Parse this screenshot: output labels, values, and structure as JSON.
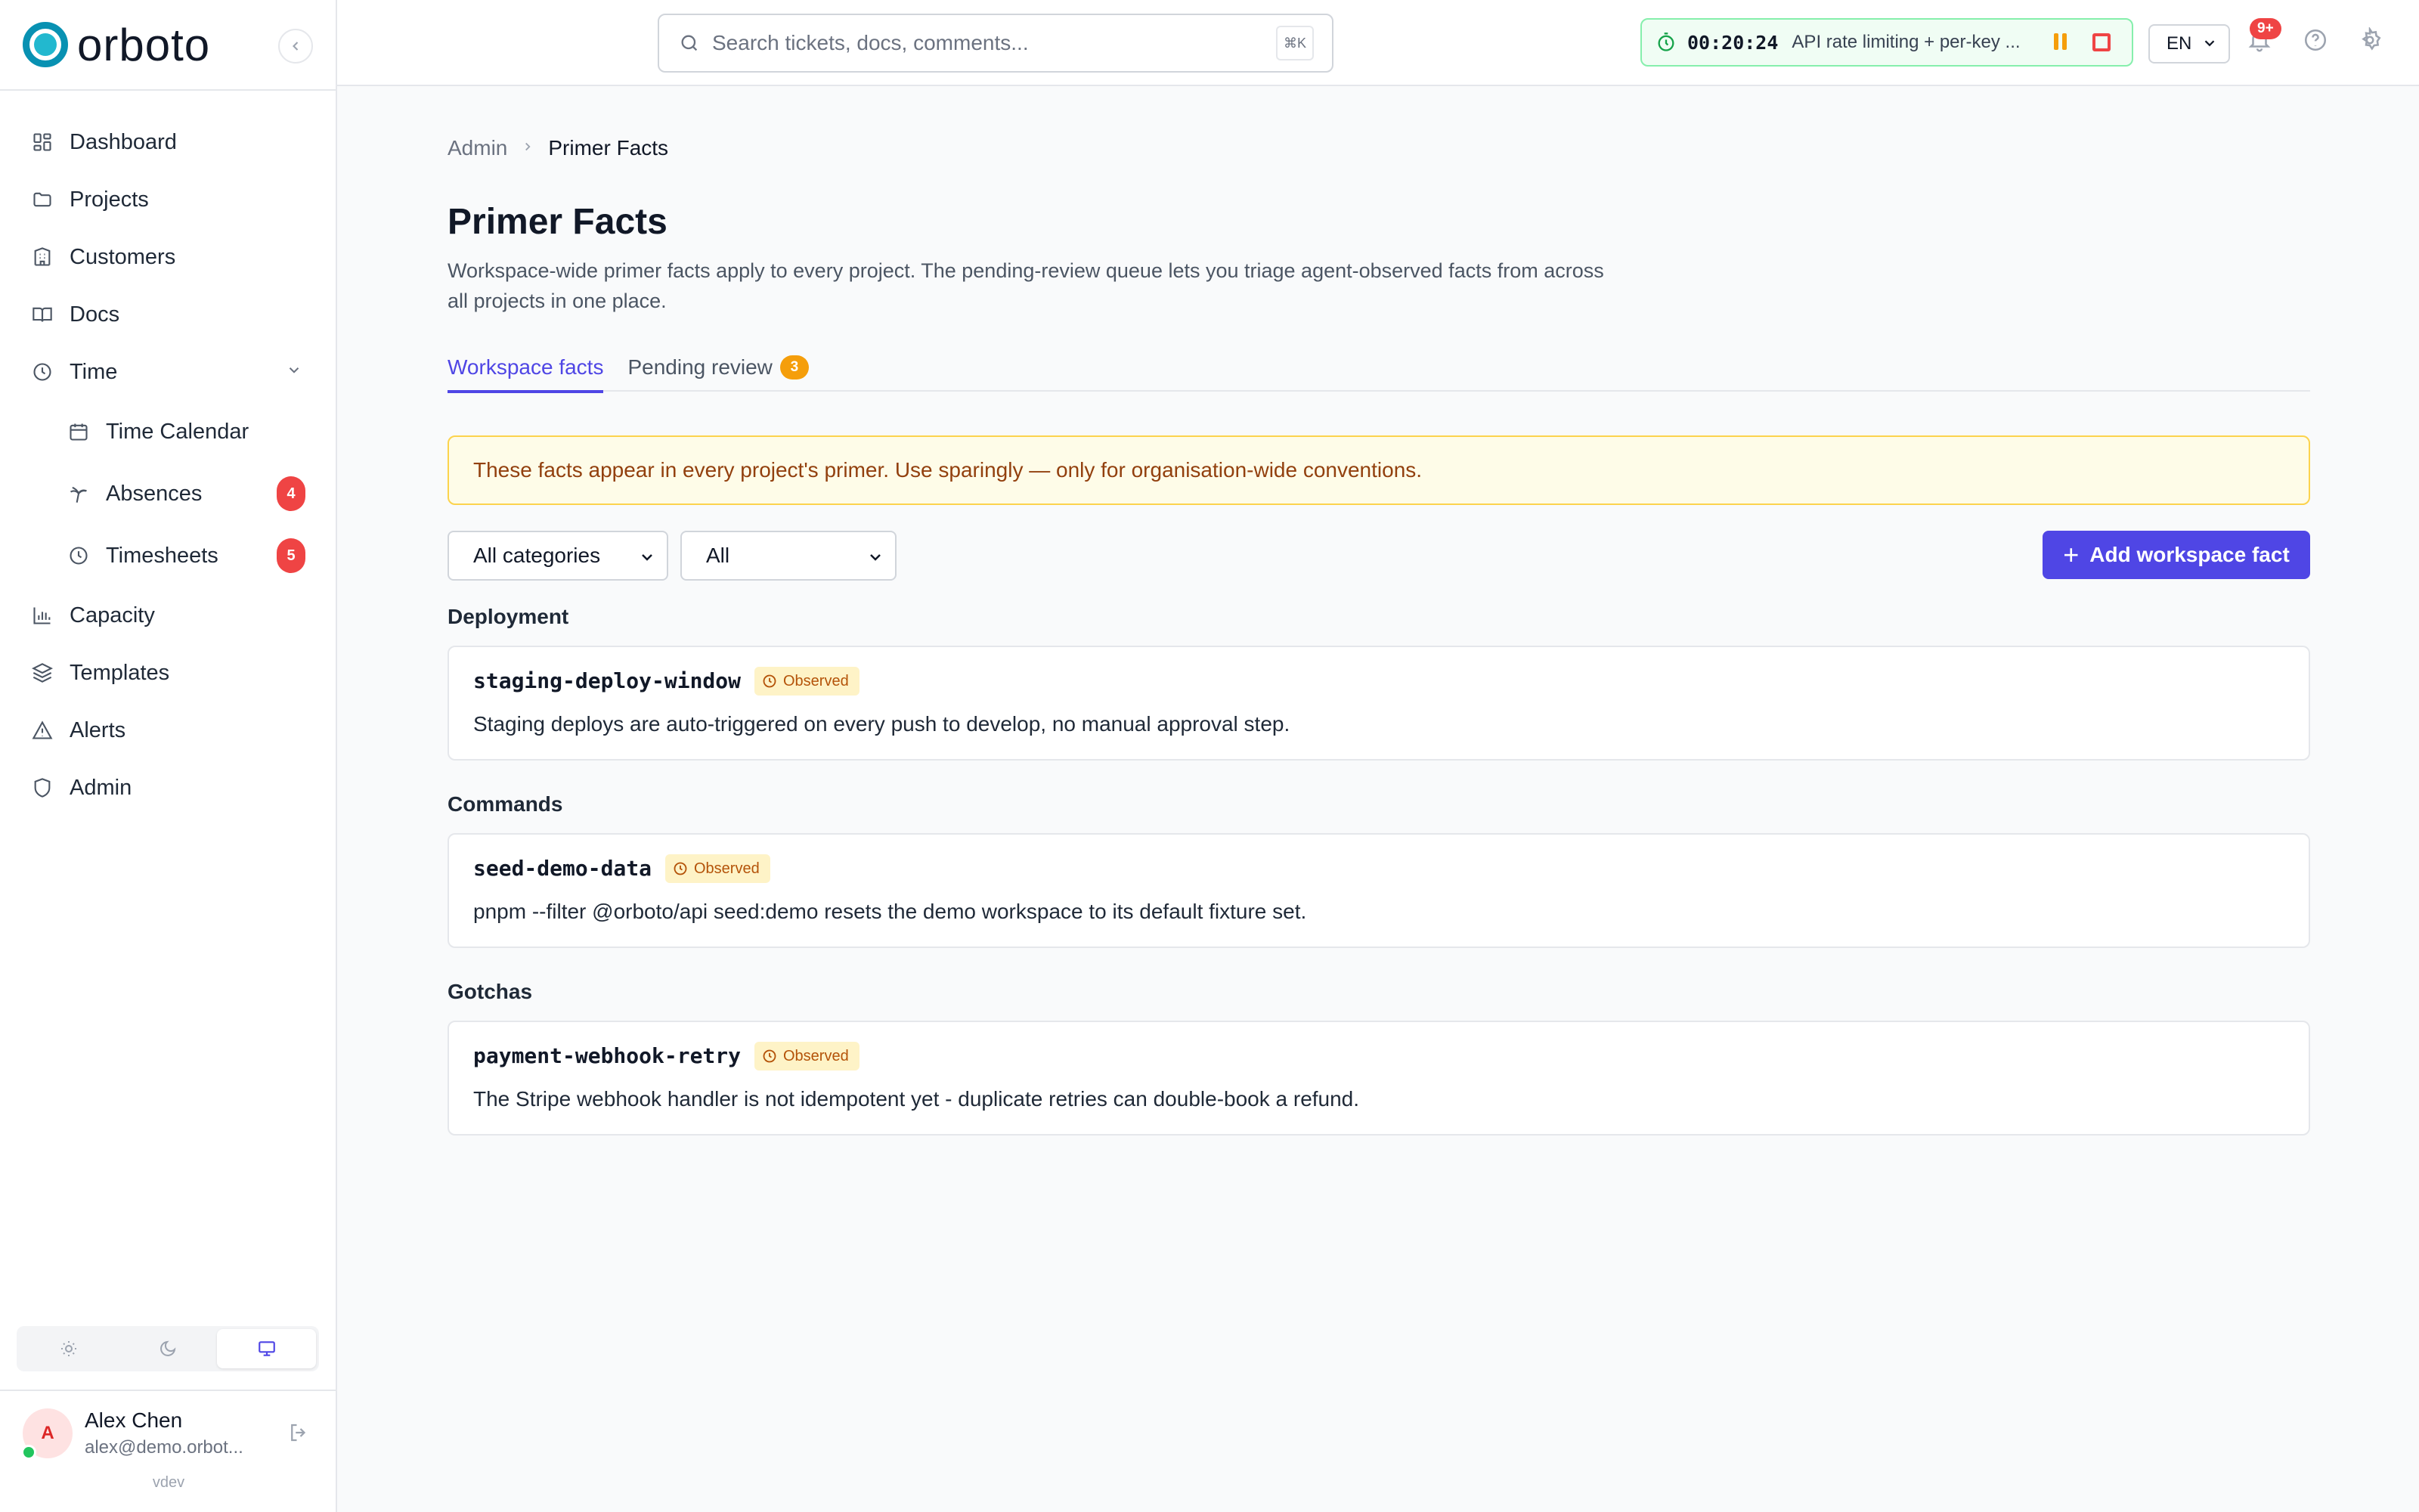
{
  "app": {
    "logo_text": "orboto",
    "version": "vdev"
  },
  "sidebar": {
    "items": [
      {
        "label": "Dashboard"
      },
      {
        "label": "Projects"
      },
      {
        "label": "Customers"
      },
      {
        "label": "Docs"
      },
      {
        "label": "Time"
      },
      {
        "label": "Time Calendar"
      },
      {
        "label": "Absences",
        "badge": "4"
      },
      {
        "label": "Timesheets",
        "badge": "5"
      },
      {
        "label": "Capacity"
      },
      {
        "label": "Templates"
      },
      {
        "label": "Alerts"
      },
      {
        "label": "Admin"
      }
    ],
    "theme": {
      "selected": "system"
    },
    "user": {
      "initial": "A",
      "name": "Alex Chen",
      "email": "alex@demo.orbot..."
    }
  },
  "topbar": {
    "search_placeholder": "Search tickets, docs, comments...",
    "search_shortcut": "⌘K",
    "timer": {
      "elapsed": "00:20:24",
      "task": "API rate limiting + per-key ..."
    },
    "language": "EN",
    "notifications_count": "9+"
  },
  "breadcrumb": {
    "parent": "Admin",
    "current": "Primer Facts"
  },
  "page": {
    "title": "Primer Facts",
    "description": "Workspace-wide primer facts apply to every project. The pending-review queue lets you triage agent-observed facts from across all projects in one place."
  },
  "tabs": [
    {
      "label": "Workspace facts",
      "active": true
    },
    {
      "label": "Pending review",
      "count": "3"
    }
  ],
  "notice": "These facts appear in every project's primer. Use sparingly — only for organisation-wide conventions.",
  "filters": {
    "category": "All categories",
    "status": "All"
  },
  "add_button": "Add workspace fact",
  "groups": [
    {
      "title": "Deployment",
      "facts": [
        {
          "key": "staging-deploy-window",
          "status": "Observed",
          "text": "Staging deploys are auto-triggered on every push to develop, no manual approval step."
        }
      ]
    },
    {
      "title": "Commands",
      "facts": [
        {
          "key": "seed-demo-data",
          "status": "Observed",
          "text": "pnpm --filter @orboto/api seed:demo resets the demo workspace to its default fixture set."
        }
      ]
    },
    {
      "title": "Gotchas",
      "facts": [
        {
          "key": "payment-webhook-retry",
          "status": "Observed",
          "text": "The Stripe webhook handler is not idempotent yet - duplicate retries can double-book a refund."
        }
      ]
    }
  ],
  "colors": {
    "accent": "#4f46e5",
    "brand": "#0891b2",
    "danger": "#ef4444",
    "warning": "#f59e0b"
  }
}
